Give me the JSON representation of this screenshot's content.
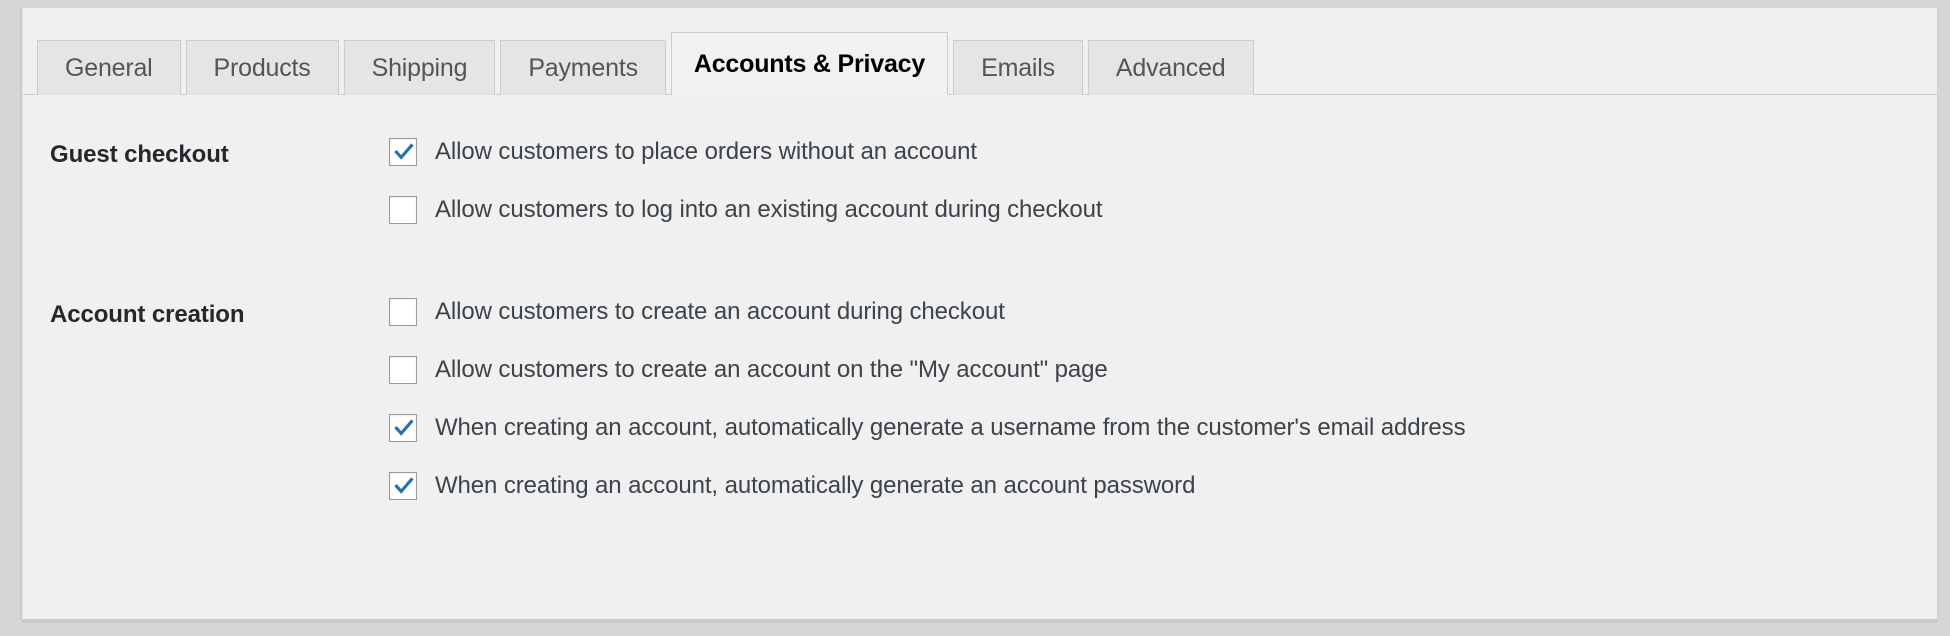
{
  "theme": {
    "page_bg": "#d6d6d6",
    "panel_bg": "#f0f0f0",
    "tab_bg": "#e5e5e5",
    "tab_active_bg": "#f1f1f1",
    "border": "#cccccc",
    "text": "#3c434a",
    "heading": "#23282d",
    "checkbox_accent": "#2271b1"
  },
  "tabs": [
    {
      "label": "General",
      "active": false
    },
    {
      "label": "Products",
      "active": false
    },
    {
      "label": "Shipping",
      "active": false
    },
    {
      "label": "Payments",
      "active": false
    },
    {
      "label": "Accounts & Privacy",
      "active": true
    },
    {
      "label": "Emails",
      "active": false
    },
    {
      "label": "Advanced",
      "active": false
    }
  ],
  "groups": [
    {
      "label": "Guest checkout",
      "options": [
        {
          "label": "Allow customers to place orders without an account",
          "checked": true
        },
        {
          "label": "Allow customers to log into an existing account during checkout",
          "checked": false
        }
      ]
    },
    {
      "label": "Account creation",
      "options": [
        {
          "label": "Allow customers to create an account during checkout",
          "checked": false
        },
        {
          "label": "Allow customers to create an account on the \"My account\" page",
          "checked": false
        },
        {
          "label": "When creating an account, automatically generate a username from the customer's email address",
          "checked": true
        },
        {
          "label": "When creating an account, automatically generate an account password",
          "checked": true
        }
      ]
    }
  ],
  "icons": {
    "checkmark": "check-icon"
  }
}
